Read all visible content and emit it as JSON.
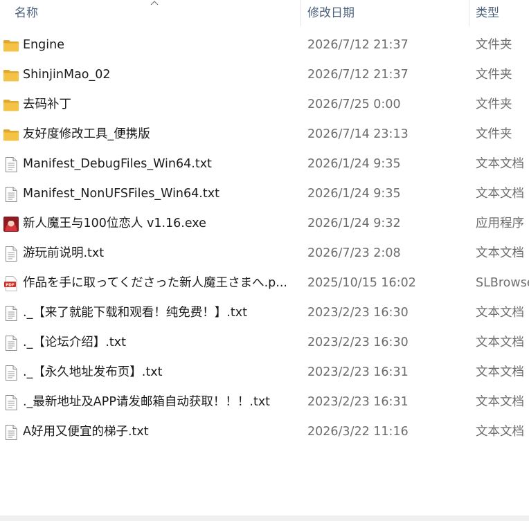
{
  "columns": {
    "name": "名称",
    "date": "修改日期",
    "type": "类型"
  },
  "files": [
    {
      "name": "Engine",
      "date": "2026/7/12 21:37",
      "type": "文件夹",
      "icon": "folder-icon"
    },
    {
      "name": "ShinjinMao_02",
      "date": "2026/7/12 21:37",
      "type": "文件夹",
      "icon": "folder-icon"
    },
    {
      "name": "去码补丁",
      "date": "2026/7/25 0:00",
      "type": "文件夹",
      "icon": "folder-icon"
    },
    {
      "name": "友好度修改工具_便携版",
      "date": "2026/7/14 23:13",
      "type": "文件夹",
      "icon": "folder-icon"
    },
    {
      "name": "Manifest_DebugFiles_Win64.txt",
      "date": "2026/1/24 9:35",
      "type": "文本文档",
      "icon": "text-file-icon"
    },
    {
      "name": "Manifest_NonUFSFiles_Win64.txt",
      "date": "2026/1/24 9:35",
      "type": "文本文档",
      "icon": "text-file-icon"
    },
    {
      "name": "新人魔王与100位恋人 v1.16.exe",
      "date": "2026/1/24 9:32",
      "type": "应用程序",
      "icon": "app-icon"
    },
    {
      "name": "游玩前说明.txt",
      "date": "2026/7/23 2:08",
      "type": "文本文档",
      "icon": "text-file-icon"
    },
    {
      "name": "作品を手に取ってくださった新人魔王さまへ.p...",
      "date": "2025/10/15 16:02",
      "type": "SLBrowse",
      "icon": "pdf-icon"
    },
    {
      "name": "._【来了就能下载和观看！纯免费！】.txt",
      "date": "2023/2/23 16:30",
      "type": "文本文档",
      "icon": "text-file-icon"
    },
    {
      "name": "._【论坛介绍】.txt",
      "date": "2023/2/23 16:30",
      "type": "文本文档",
      "icon": "text-file-icon"
    },
    {
      "name": "._【永久地址发布页】.txt",
      "date": "2023/2/23 16:31",
      "type": "文本文档",
      "icon": "text-file-icon"
    },
    {
      "name": "._最新地址及APP请发邮箱自动获取！！！.txt",
      "date": "2023/2/23 16:31",
      "type": "文本文档",
      "icon": "text-file-icon"
    },
    {
      "name": "A好用又便宜的梯子.txt",
      "date": "2026/3/22 11:16",
      "type": "文本文档",
      "icon": "text-file-icon"
    }
  ],
  "pdf_badge": "PDF",
  "colors": {
    "folder": "#f4c245",
    "folder_dark": "#e0a82e",
    "header_text": "#4a5f7a",
    "secondary_text": "#6d6d6d"
  }
}
